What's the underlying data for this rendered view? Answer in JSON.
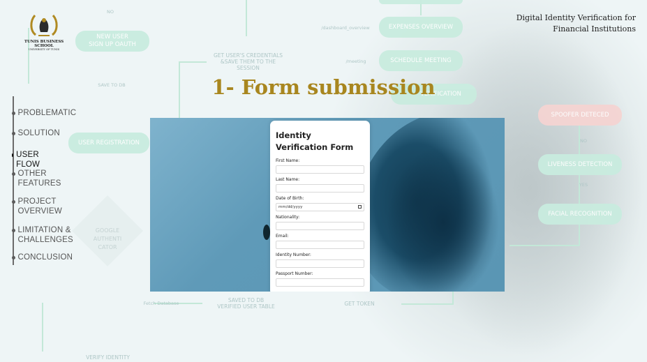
{
  "slide": {
    "header_title_line1": "Digital Identity Verification for",
    "header_title_line2": "Financial Institutions",
    "section_title": "1- Form submission",
    "logo": {
      "name": "TUNIS BUSINESS SCHOOL",
      "sub": "UNIVERSITY OF TUNIS"
    }
  },
  "nav": {
    "items": [
      {
        "label": "PROBLEMATIC",
        "active": false
      },
      {
        "label": "SOLUTION",
        "active": false
      },
      {
        "label": "USER FLOW",
        "active": true
      },
      {
        "label": "OTHER\nFEATURES",
        "active": false
      },
      {
        "label": "PROJECT\nOVERVIEW",
        "active": false
      },
      {
        "label": "LIMITATION &\nCHALLENGES",
        "active": false
      },
      {
        "label": "CONCLUSION",
        "active": false
      }
    ]
  },
  "flow_background": {
    "pills": {
      "new_user": "NEW USER\nSIGN UP OAUTH",
      "user_registration": "USER REGISTRATION",
      "expenses_overview": "EXPENSES OVERVIEW",
      "schedule_meeting": "SCHEDULE MEETING",
      "verification": "VERIFICATION",
      "spoofer_detected": "SPOOFER DETECED",
      "liveness_detection": "LIVENESS DETECTION",
      "facial_recognition": "FACIAL RECOGNITION"
    },
    "labels": {
      "no_top": "NO",
      "save_to_db": "SAVE TO DB",
      "get_credentials": "GET USER'S CREDENTIALS\n&SAVE THEM TO THE\nSESSION",
      "dashboard_overview": "/dashboard_overview",
      "meeting": "/meeting",
      "no_right": "NO",
      "yes_right": "YES",
      "google_authenticator": "GOOGLE\nAUTHENTI\nCATOR",
      "fetch_database": "Fetch Database",
      "saved_to_db": "SAVED TO DB\nVERIFIED USER TABLE",
      "get_token": "GET TOKEN",
      "verify_identity": "VERIFY IDENTITY"
    }
  },
  "form": {
    "title": "Identity Verification Form",
    "fields": [
      {
        "label": "First Name:",
        "value": ""
      },
      {
        "label": "Last Name:",
        "value": ""
      },
      {
        "label": "Date of Birth:",
        "value": "mm/dd/yyyy"
      },
      {
        "label": "Nationality:",
        "value": ""
      },
      {
        "label": "Email:",
        "value": ""
      },
      {
        "label": "Identity Number:",
        "value": ""
      },
      {
        "label": "Passport Number:",
        "value": ""
      }
    ]
  },
  "colors": {
    "accent_gold": "#a8861f",
    "flow_green": "#c9ecdf",
    "flow_red": "#f5d4d2",
    "photo_blue": "#5f9ab8"
  }
}
